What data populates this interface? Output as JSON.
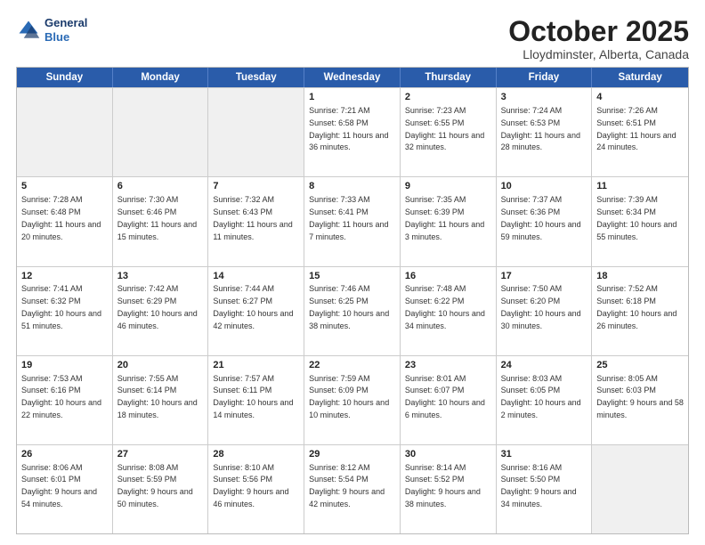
{
  "logo": {
    "line1": "General",
    "line2": "Blue"
  },
  "title": "October 2025",
  "location": "Lloydminster, Alberta, Canada",
  "header_days": [
    "Sunday",
    "Monday",
    "Tuesday",
    "Wednesday",
    "Thursday",
    "Friday",
    "Saturday"
  ],
  "weeks": [
    [
      {
        "day": "",
        "sunrise": "",
        "sunset": "",
        "daylight": "",
        "empty": true
      },
      {
        "day": "",
        "sunrise": "",
        "sunset": "",
        "daylight": "",
        "empty": true
      },
      {
        "day": "",
        "sunrise": "",
        "sunset": "",
        "daylight": "",
        "empty": true
      },
      {
        "day": "1",
        "sunrise": "Sunrise: 7:21 AM",
        "sunset": "Sunset: 6:58 PM",
        "daylight": "Daylight: 11 hours and 36 minutes."
      },
      {
        "day": "2",
        "sunrise": "Sunrise: 7:23 AM",
        "sunset": "Sunset: 6:55 PM",
        "daylight": "Daylight: 11 hours and 32 minutes."
      },
      {
        "day": "3",
        "sunrise": "Sunrise: 7:24 AM",
        "sunset": "Sunset: 6:53 PM",
        "daylight": "Daylight: 11 hours and 28 minutes."
      },
      {
        "day": "4",
        "sunrise": "Sunrise: 7:26 AM",
        "sunset": "Sunset: 6:51 PM",
        "daylight": "Daylight: 11 hours and 24 minutes."
      }
    ],
    [
      {
        "day": "5",
        "sunrise": "Sunrise: 7:28 AM",
        "sunset": "Sunset: 6:48 PM",
        "daylight": "Daylight: 11 hours and 20 minutes."
      },
      {
        "day": "6",
        "sunrise": "Sunrise: 7:30 AM",
        "sunset": "Sunset: 6:46 PM",
        "daylight": "Daylight: 11 hours and 15 minutes."
      },
      {
        "day": "7",
        "sunrise": "Sunrise: 7:32 AM",
        "sunset": "Sunset: 6:43 PM",
        "daylight": "Daylight: 11 hours and 11 minutes."
      },
      {
        "day": "8",
        "sunrise": "Sunrise: 7:33 AM",
        "sunset": "Sunset: 6:41 PM",
        "daylight": "Daylight: 11 hours and 7 minutes."
      },
      {
        "day": "9",
        "sunrise": "Sunrise: 7:35 AM",
        "sunset": "Sunset: 6:39 PM",
        "daylight": "Daylight: 11 hours and 3 minutes."
      },
      {
        "day": "10",
        "sunrise": "Sunrise: 7:37 AM",
        "sunset": "Sunset: 6:36 PM",
        "daylight": "Daylight: 10 hours and 59 minutes."
      },
      {
        "day": "11",
        "sunrise": "Sunrise: 7:39 AM",
        "sunset": "Sunset: 6:34 PM",
        "daylight": "Daylight: 10 hours and 55 minutes."
      }
    ],
    [
      {
        "day": "12",
        "sunrise": "Sunrise: 7:41 AM",
        "sunset": "Sunset: 6:32 PM",
        "daylight": "Daylight: 10 hours and 51 minutes."
      },
      {
        "day": "13",
        "sunrise": "Sunrise: 7:42 AM",
        "sunset": "Sunset: 6:29 PM",
        "daylight": "Daylight: 10 hours and 46 minutes."
      },
      {
        "day": "14",
        "sunrise": "Sunrise: 7:44 AM",
        "sunset": "Sunset: 6:27 PM",
        "daylight": "Daylight: 10 hours and 42 minutes."
      },
      {
        "day": "15",
        "sunrise": "Sunrise: 7:46 AM",
        "sunset": "Sunset: 6:25 PM",
        "daylight": "Daylight: 10 hours and 38 minutes."
      },
      {
        "day": "16",
        "sunrise": "Sunrise: 7:48 AM",
        "sunset": "Sunset: 6:22 PM",
        "daylight": "Daylight: 10 hours and 34 minutes."
      },
      {
        "day": "17",
        "sunrise": "Sunrise: 7:50 AM",
        "sunset": "Sunset: 6:20 PM",
        "daylight": "Daylight: 10 hours and 30 minutes."
      },
      {
        "day": "18",
        "sunrise": "Sunrise: 7:52 AM",
        "sunset": "Sunset: 6:18 PM",
        "daylight": "Daylight: 10 hours and 26 minutes."
      }
    ],
    [
      {
        "day": "19",
        "sunrise": "Sunrise: 7:53 AM",
        "sunset": "Sunset: 6:16 PM",
        "daylight": "Daylight: 10 hours and 22 minutes."
      },
      {
        "day": "20",
        "sunrise": "Sunrise: 7:55 AM",
        "sunset": "Sunset: 6:14 PM",
        "daylight": "Daylight: 10 hours and 18 minutes."
      },
      {
        "day": "21",
        "sunrise": "Sunrise: 7:57 AM",
        "sunset": "Sunset: 6:11 PM",
        "daylight": "Daylight: 10 hours and 14 minutes."
      },
      {
        "day": "22",
        "sunrise": "Sunrise: 7:59 AM",
        "sunset": "Sunset: 6:09 PM",
        "daylight": "Daylight: 10 hours and 10 minutes."
      },
      {
        "day": "23",
        "sunrise": "Sunrise: 8:01 AM",
        "sunset": "Sunset: 6:07 PM",
        "daylight": "Daylight: 10 hours and 6 minutes."
      },
      {
        "day": "24",
        "sunrise": "Sunrise: 8:03 AM",
        "sunset": "Sunset: 6:05 PM",
        "daylight": "Daylight: 10 hours and 2 minutes."
      },
      {
        "day": "25",
        "sunrise": "Sunrise: 8:05 AM",
        "sunset": "Sunset: 6:03 PM",
        "daylight": "Daylight: 9 hours and 58 minutes."
      }
    ],
    [
      {
        "day": "26",
        "sunrise": "Sunrise: 8:06 AM",
        "sunset": "Sunset: 6:01 PM",
        "daylight": "Daylight: 9 hours and 54 minutes."
      },
      {
        "day": "27",
        "sunrise": "Sunrise: 8:08 AM",
        "sunset": "Sunset: 5:59 PM",
        "daylight": "Daylight: 9 hours and 50 minutes."
      },
      {
        "day": "28",
        "sunrise": "Sunrise: 8:10 AM",
        "sunset": "Sunset: 5:56 PM",
        "daylight": "Daylight: 9 hours and 46 minutes."
      },
      {
        "day": "29",
        "sunrise": "Sunrise: 8:12 AM",
        "sunset": "Sunset: 5:54 PM",
        "daylight": "Daylight: 9 hours and 42 minutes."
      },
      {
        "day": "30",
        "sunrise": "Sunrise: 8:14 AM",
        "sunset": "Sunset: 5:52 PM",
        "daylight": "Daylight: 9 hours and 38 minutes."
      },
      {
        "day": "31",
        "sunrise": "Sunrise: 8:16 AM",
        "sunset": "Sunset: 5:50 PM",
        "daylight": "Daylight: 9 hours and 34 minutes."
      },
      {
        "day": "",
        "sunrise": "",
        "sunset": "",
        "daylight": "",
        "empty": true
      }
    ]
  ]
}
